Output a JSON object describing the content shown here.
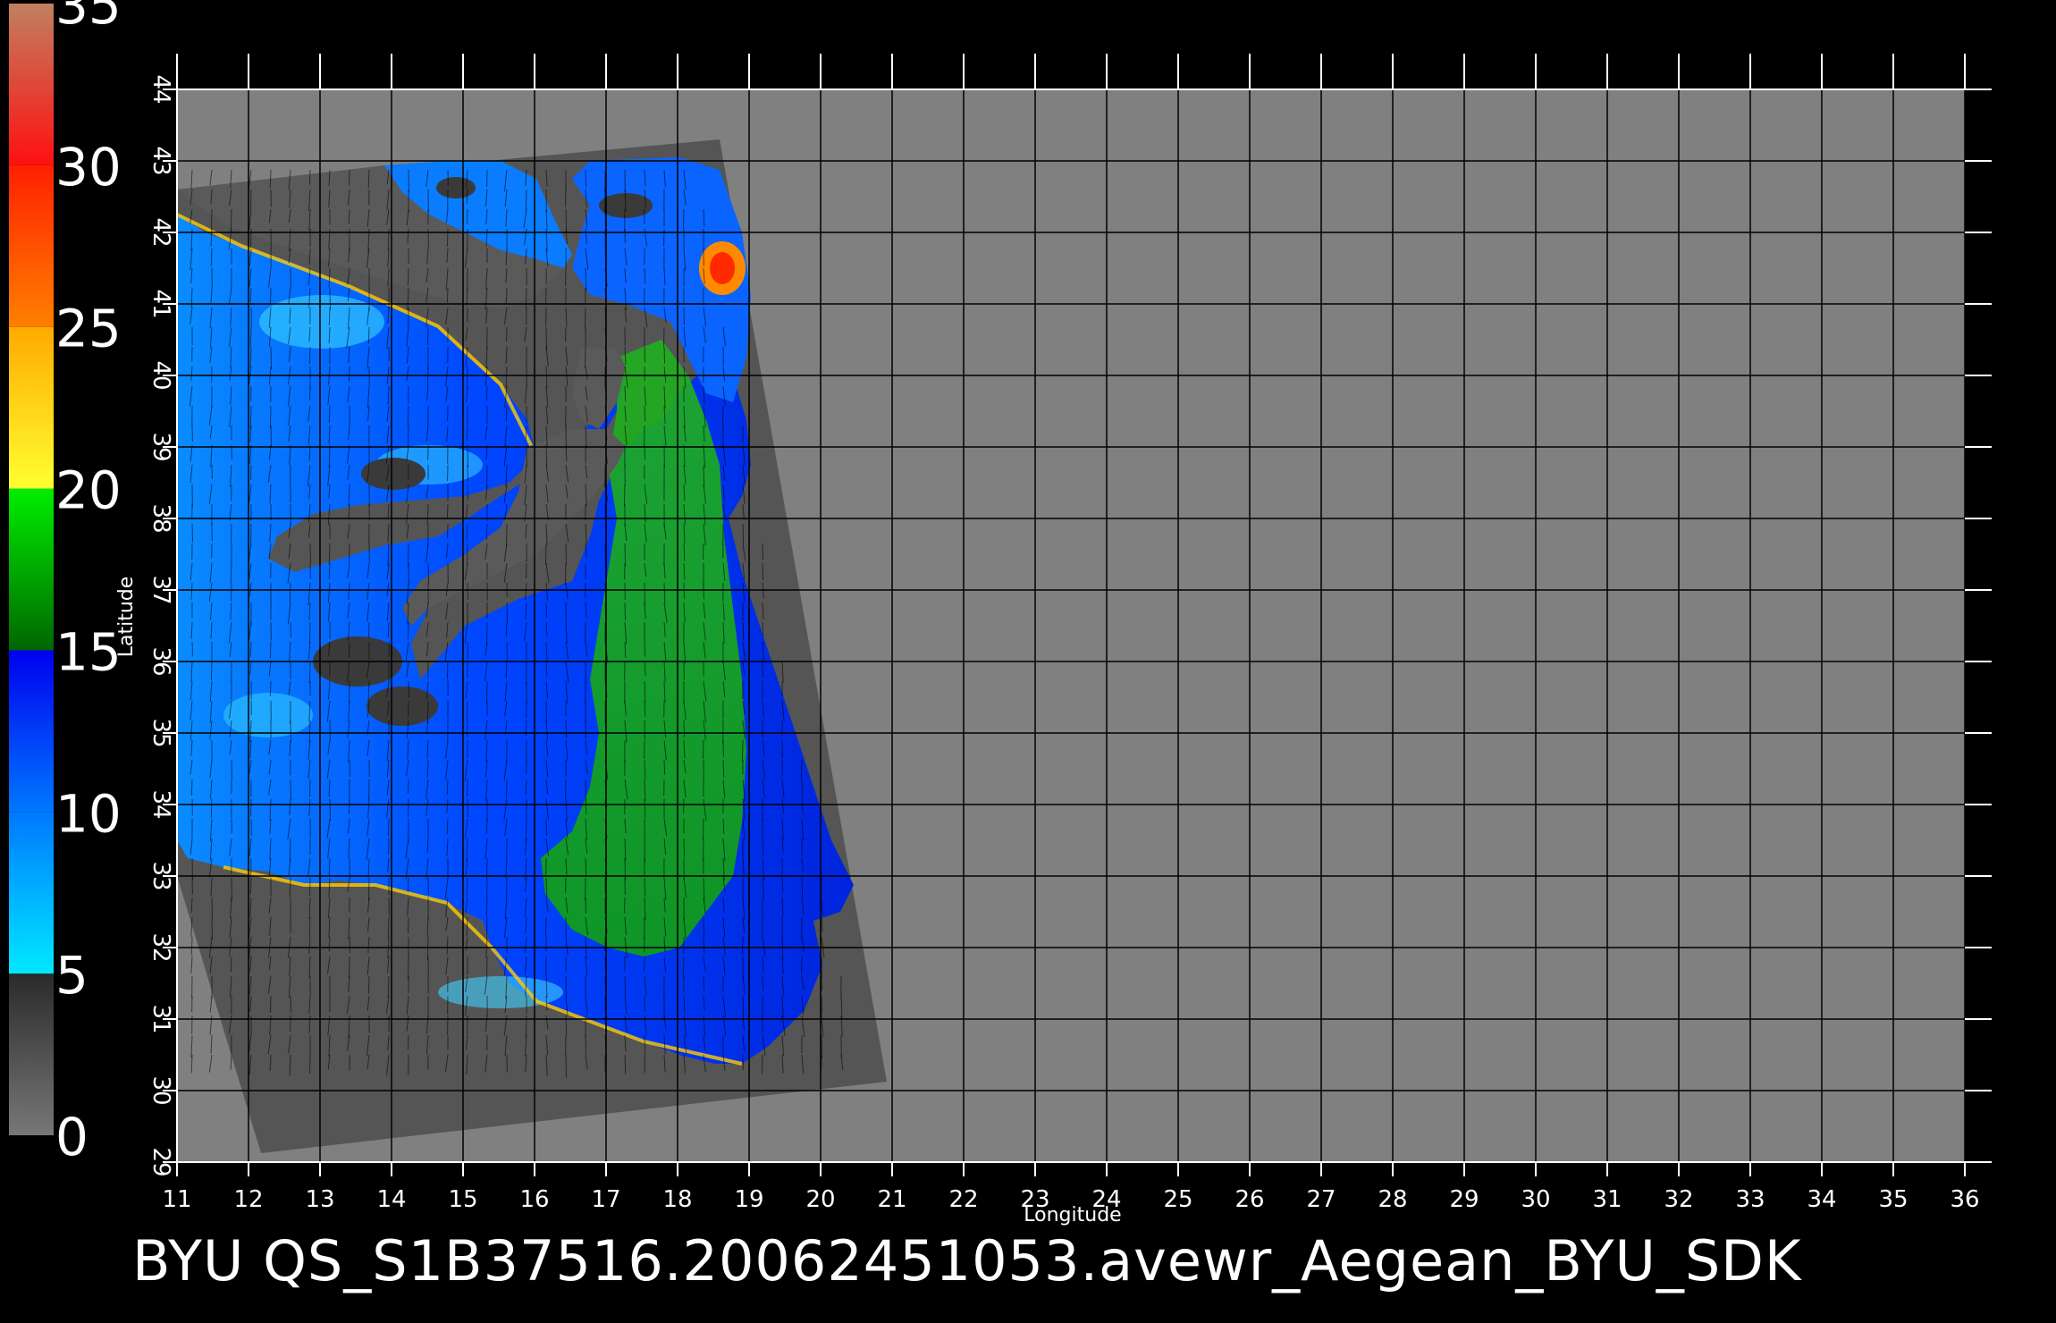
{
  "map": {
    "xlabel": "Longitude",
    "ylabel": "Latitude",
    "lon_range": [
      11,
      36
    ],
    "lat_range": [
      29,
      44
    ],
    "lon_ticks": [
      "11",
      "12",
      "13",
      "14",
      "15",
      "16",
      "17",
      "18",
      "19",
      "20",
      "21",
      "22",
      "23",
      "24",
      "25",
      "26",
      "27",
      "28",
      "29",
      "30",
      "31",
      "32",
      "33",
      "34",
      "35",
      "36"
    ],
    "lat_ticks": [
      "29",
      "30",
      "31",
      "32",
      "33",
      "34",
      "35",
      "36",
      "37",
      "38",
      "39",
      "40",
      "41",
      "42",
      "43",
      "44"
    ],
    "footer": "BYU  QS_S1B37516.20062451053.avewr_Aegean_BYU_SDK"
  },
  "colorbar": {
    "labels": [
      "0",
      "5",
      "10",
      "15",
      "20",
      "25",
      "30",
      "35"
    ],
    "stops": [
      {
        "from": 0,
        "to": 5,
        "color_low": "#777777",
        "color_high": "#2a2a2a"
      },
      {
        "from": 5,
        "to": 10,
        "color_low": "#00e8ff",
        "color_high": "#0078ff"
      },
      {
        "from": 10,
        "to": 15,
        "color_low": "#0078ff",
        "color_high": "#0000ee"
      },
      {
        "from": 15,
        "to": 20,
        "color_low": "#006600",
        "color_high": "#00ee00"
      },
      {
        "from": 20,
        "to": 25,
        "color_low": "#ffff30",
        "color_high": "#ffaa00"
      },
      {
        "from": 25,
        "to": 30,
        "color_low": "#ff8000",
        "color_high": "#ff2000"
      },
      {
        "from": 30,
        "to": 35,
        "color_low": "#ff1010",
        "color_high": "#c08060"
      }
    ]
  },
  "colors": {
    "background": "#000000",
    "map_fill": "#808080",
    "swath_fill": "#555555",
    "land_fill": "#5a5a5a",
    "grid": "#000000",
    "text": "#ffffff"
  }
}
